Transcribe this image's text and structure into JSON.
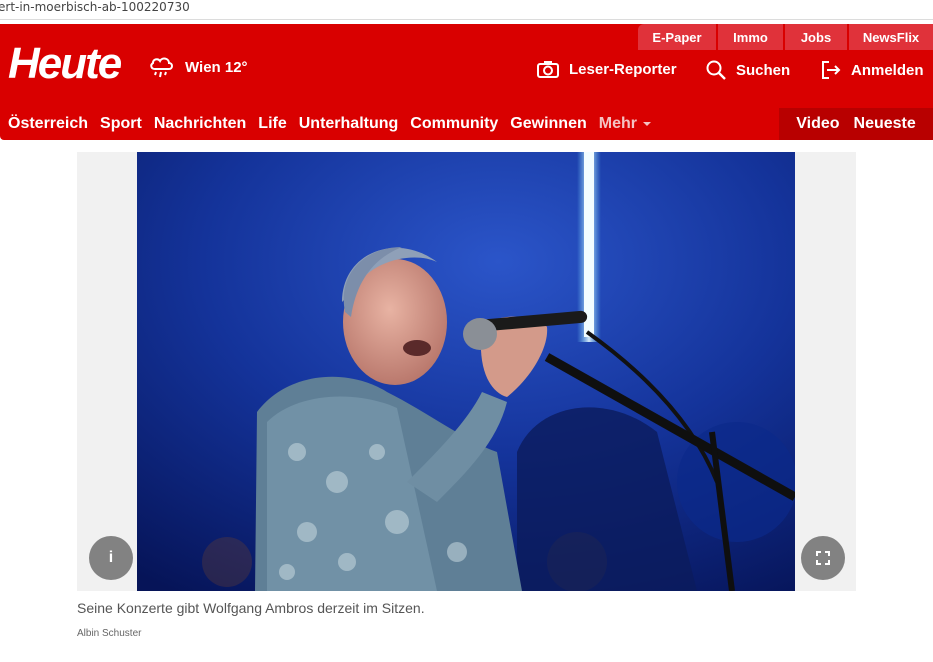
{
  "browser": {
    "url_fragment": "ert-in-moerbisch-ab-100220730"
  },
  "topbar": {
    "tabs": [
      "E-Paper",
      "Immo",
      "Jobs",
      "NewsFlix"
    ]
  },
  "header": {
    "logo": "Heute",
    "weather": "Wien 12°",
    "leser_reporter": "Leser-Reporter",
    "search": "Suchen",
    "login": "Anmelden"
  },
  "nav": {
    "items": [
      "Österreich",
      "Sport",
      "Nachrichten",
      "Life",
      "Unterhaltung",
      "Community",
      "Gewinnen"
    ],
    "more": "Mehr",
    "right": [
      "Video",
      "Neueste"
    ]
  },
  "article": {
    "info_button": "i",
    "caption": "Seine Konzerte gibt Wolfgang Ambros derzeit im Sitzen.",
    "credit": "Albin Schuster"
  },
  "colors": {
    "brand_red": "#d90000",
    "dark_red": "#b80000",
    "tab_red": "#e0323a"
  },
  "icons": [
    "rain-cloud-icon",
    "camera-icon",
    "search-icon",
    "login-icon",
    "chevron-down-icon",
    "expand-icon"
  ]
}
